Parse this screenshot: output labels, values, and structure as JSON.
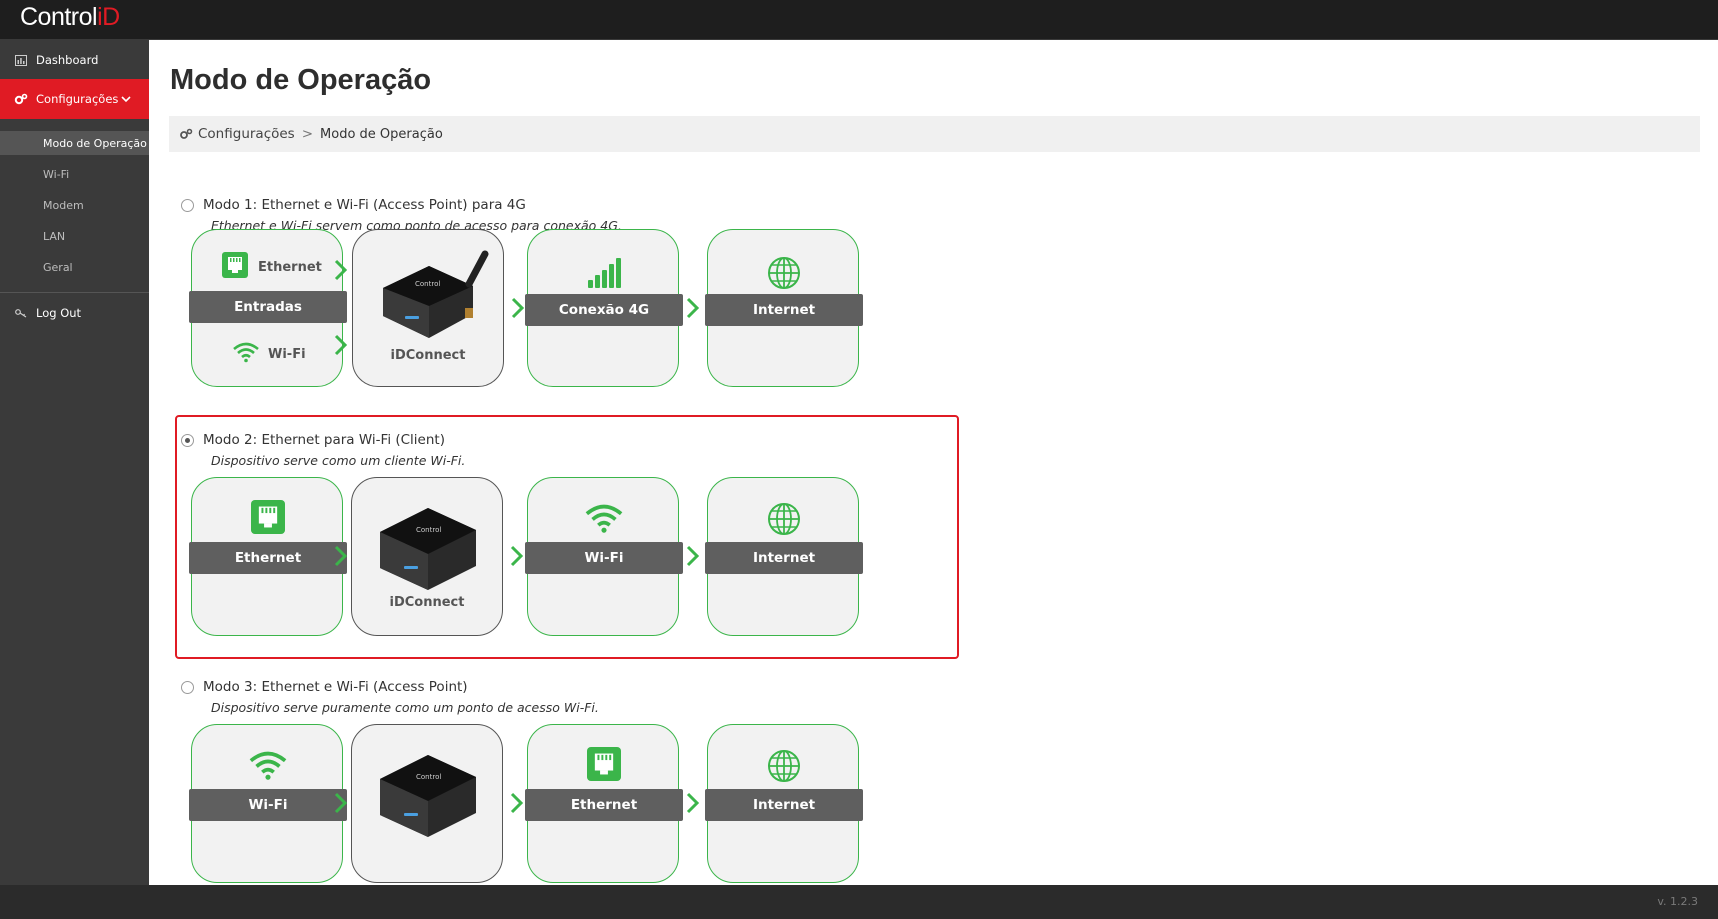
{
  "app": {
    "brand_main": "Control",
    "brand_accent": "iD",
    "version": "v. 1.2.3",
    "accent_color": "#e01b24",
    "green_color": "#3bb54a"
  },
  "sidebar": {
    "items": [
      {
        "label": "Dashboard",
        "icon": "chart-icon"
      },
      {
        "label": "Configurações",
        "icon": "gears-icon"
      },
      {
        "label": "Log Out",
        "icon": "key-icon"
      }
    ],
    "sub_items": [
      "Modo de Operação",
      "Wi-Fi",
      "Modem",
      "LAN",
      "Geral"
    ]
  },
  "page": {
    "title": "Modo de Operação",
    "breadcrumb": {
      "root": "Configurações",
      "separator": ">",
      "current": "Modo de Operação"
    }
  },
  "modes": [
    {
      "title": "Modo 1: Ethernet e Wi-Fi (Access Point) para 4G",
      "desc": "Ethernet e Wi-Fi servem como ponto de acesso para conexão 4G.",
      "selected": false,
      "inputs_label": "Entradas",
      "ethernet_label": "Ethernet",
      "wifi_label": "Wi-Fi",
      "device_label": "iDConnect",
      "conn_label": "Conexão 4G",
      "internet_label": "Internet"
    },
    {
      "title": "Modo 2: Ethernet para Wi-Fi (Client)",
      "desc": "Dispositivo serve como um cliente Wi-Fi.",
      "selected": true,
      "ethernet_label": "Ethernet",
      "device_label": "iDConnect",
      "wifi_label": "Wi-Fi",
      "internet_label": "Internet"
    },
    {
      "title": "Modo 3: Ethernet e Wi-Fi (Access Point)",
      "desc": "Dispositivo serve puramente como um ponto de acesso Wi-Fi.",
      "selected": false,
      "wifi_label": "Wi-Fi",
      "ethernet_label": "Ethernet",
      "internet_label": "Internet"
    }
  ]
}
